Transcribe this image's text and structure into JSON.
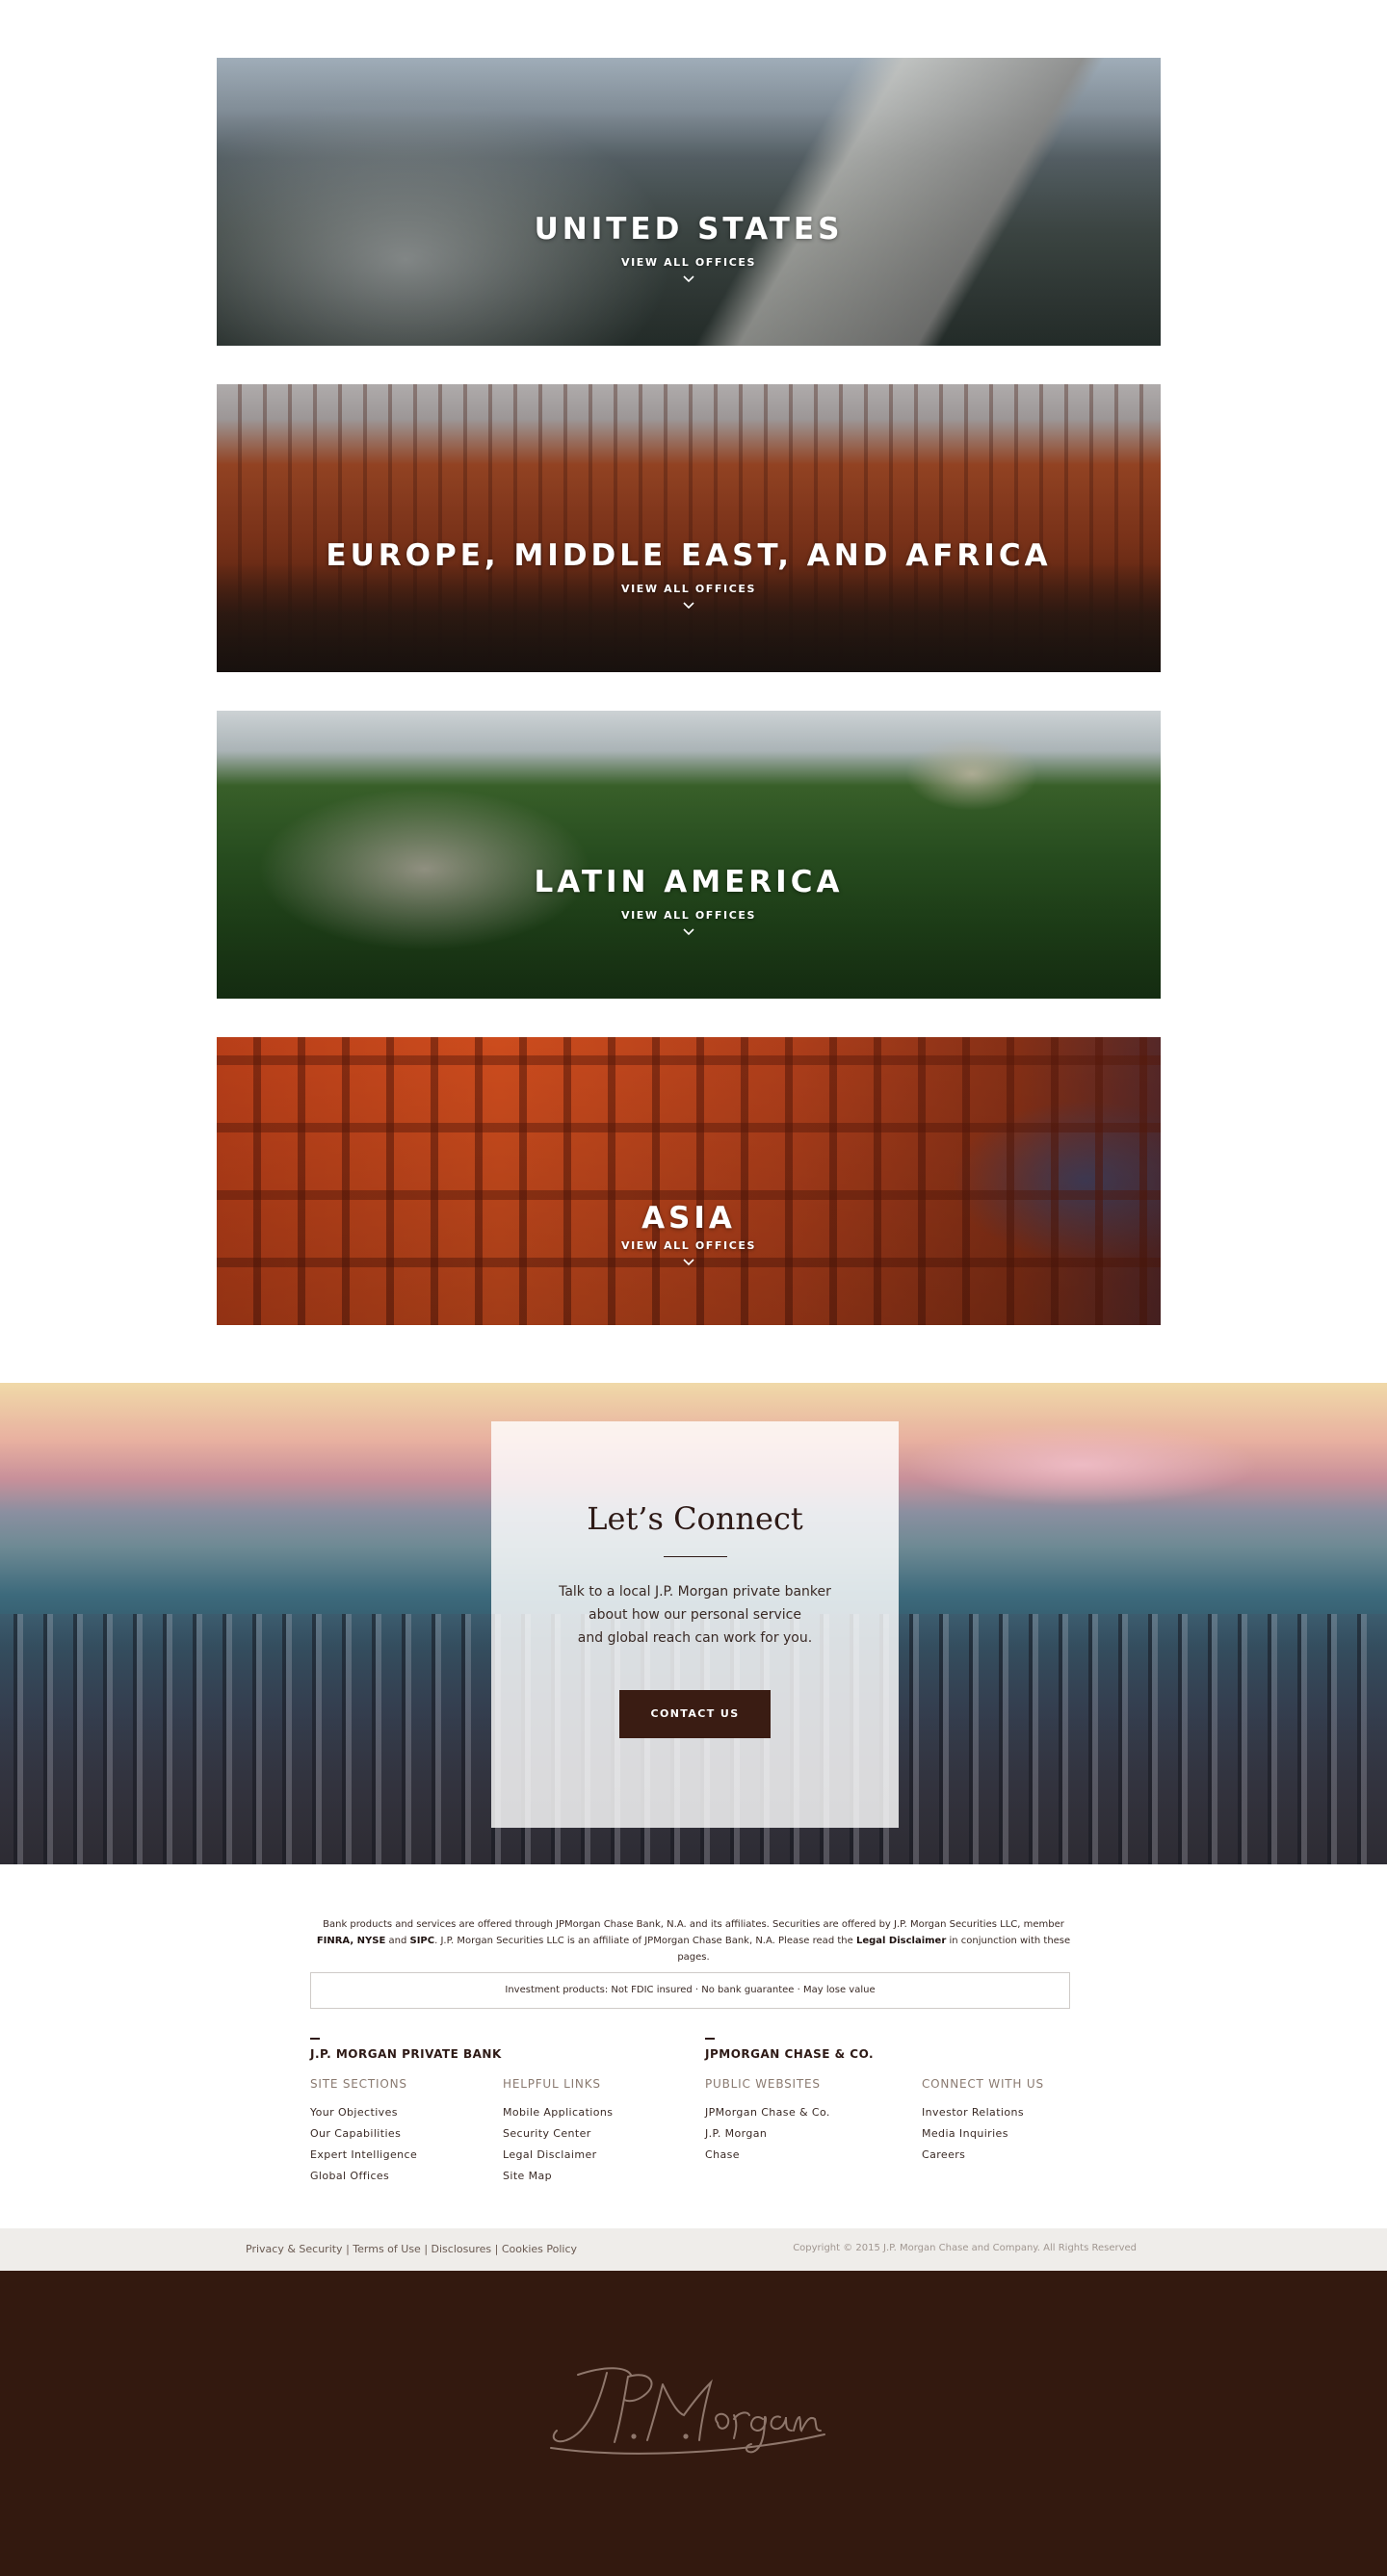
{
  "regions": [
    {
      "title": "UNITED STATES",
      "link": "VIEW ALL OFFICES"
    },
    {
      "title": "EUROPE, MIDDLE EAST, AND AFRICA",
      "link": "VIEW ALL OFFICES"
    },
    {
      "title": "LATIN AMERICA",
      "link": "VIEW ALL OFFICES"
    },
    {
      "title": "ASIA",
      "link": "VIEW ALL OFFICES"
    }
  ],
  "connect": {
    "title": "Let’s Connect",
    "line1": "Talk to a local J.P. Morgan private banker",
    "line2": "about how our personal service",
    "line3": "and global reach can work for you.",
    "button": "CONTACT US"
  },
  "legal": {
    "text1": "Bank products and services are offered through JPMorgan Chase Bank, N.A. and its affiliates. Securities are offered by J.P. Morgan Securities LLC, member",
    "finra": "FINRA, NYSE",
    "and": "and",
    "sipc": "SIPC",
    "text2": ". J.P. Morgan Securities LLC is an affiliate of JPMorgan Chase Bank, N.A. Please read the",
    "disclaimer": "Legal Disclaimer",
    "text3": "in conjunction with these pages.",
    "investment": "Investment products: Not FDIC insured · No bank guarantee · May lose value"
  },
  "footer": {
    "left_heading": "J.P. MORGAN PRIVATE BANK",
    "right_heading": "JPMORGAN CHASE & CO.",
    "site_sections": {
      "title": "SITE SECTIONS",
      "items": [
        "Your Objectives",
        "Our Capabilities",
        "Expert Intelligence",
        "Global Offices"
      ]
    },
    "helpful_links": {
      "title": "HELPFUL LINKS",
      "items": [
        "Mobile Applications",
        "Security Center",
        "Legal Disclaimer",
        "Site Map"
      ]
    },
    "public_websites": {
      "title": "PUBLIC WEBSITES",
      "items": [
        "JPMorgan Chase & Co.",
        "J.P. Morgan",
        "Chase"
      ]
    },
    "connect_with_us": {
      "title": "CONNECT WITH US",
      "items": [
        "Investor Relations",
        "Media Inquiries",
        "Careers"
      ]
    }
  },
  "subfooter": {
    "links": [
      "Privacy & Security",
      "Terms of Use",
      "Disclosures",
      "Cookies Policy"
    ],
    "separator": " | ",
    "copyright": "Copyright © 2015 J.P. Morgan Chase and Company. All Rights Reserved"
  },
  "brand": {
    "logo_text": "J.P. Morgan"
  },
  "colors": {
    "brand_brown": "#33190f",
    "button_brown": "#3a1c13",
    "subfooter_bg": "#efedea"
  }
}
